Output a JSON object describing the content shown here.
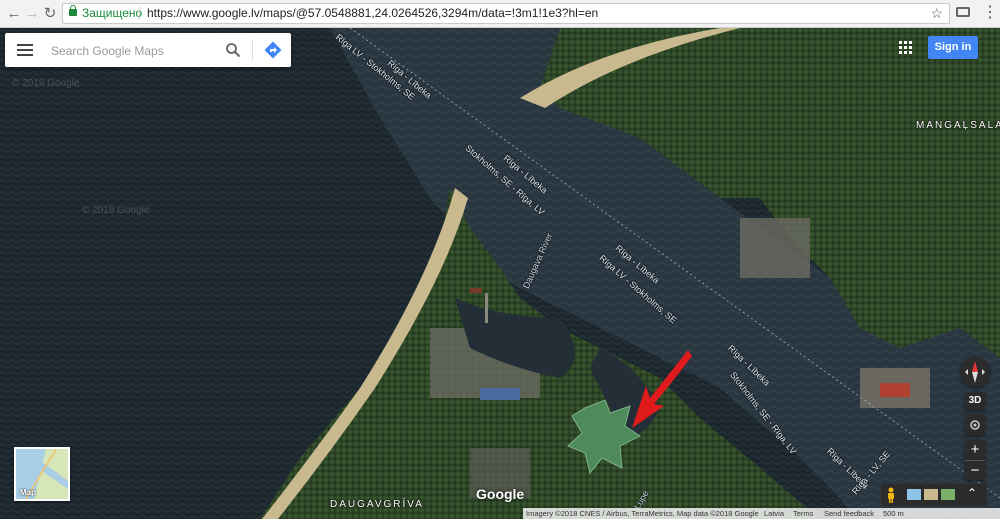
{
  "browser": {
    "secure_label": "Защищено",
    "url": "https://www.google.lv/maps/@57.0548881,24.0264526,3294m/data=!3m1!1e3?hl=en",
    "back_icon": "back-arrow-icon",
    "forward_icon": "forward-arrow-icon",
    "reload_icon": "reload-icon",
    "bookmark_icon": "star-icon",
    "cast_icon": "cast-icon",
    "menu_icon": "kebab-menu-icon",
    "menu_glyph": "⋮",
    "back_glyph": "←",
    "forward_glyph": "→",
    "reload_glyph": "↻",
    "star_glyph": "☆"
  },
  "search": {
    "placeholder": "Search Google Maps"
  },
  "header": {
    "signin_label": "Sign in"
  },
  "map": {
    "view": "satellite",
    "colors": {
      "water": "#1f2b33",
      "sea": "#242d33",
      "sand": "#c8b890",
      "forest": "#2f4a28",
      "arrow": "#e01b1b"
    },
    "watermarks": [
      "© 2018 Google",
      "© 2018 Google"
    ],
    "labels": {
      "lane_1": "Rīga LV - Stokholms, SE",
      "lane_2": "Rīga - Lībeka",
      "lane_3": "Stokholms, SE - Rīga, LV",
      "lane_4": "Rīga - Lībeka",
      "lane_5": "Rīga - Lībeka",
      "lane_6": "Rīga LV - Stokholms, SE",
      "lane_7": "Rīga - Lībeka",
      "lane_8": "Stokholms, SE - Rīga, LV",
      "lane_9": "Rīga - Lībeka",
      "lane_10": "Rīga - LV, SE",
      "river": "Daugava River",
      "lupe": "Lupe",
      "place_1": "MANGAĻSALA",
      "place_2": "DAUGAVGRĪVA"
    },
    "minimap_label": "Map",
    "google_logo": "Google",
    "controls": {
      "compass_icon": "compass-icon",
      "three_d": "3D",
      "locate_icon": "my-location-icon",
      "zoom_in": "+",
      "zoom_out": "−",
      "pegman_icon": "pegman-icon",
      "expand_icon": "chevron-up-icon",
      "expand_glyph": "⌃"
    }
  },
  "footer": {
    "imagery": "Imagery ©2018 CNES / Airbus, TerraMetrics, Map data ©2018 Google",
    "country": "Latvia",
    "terms": "Terms",
    "feedback": "Send feedback",
    "scale": "500 m"
  }
}
